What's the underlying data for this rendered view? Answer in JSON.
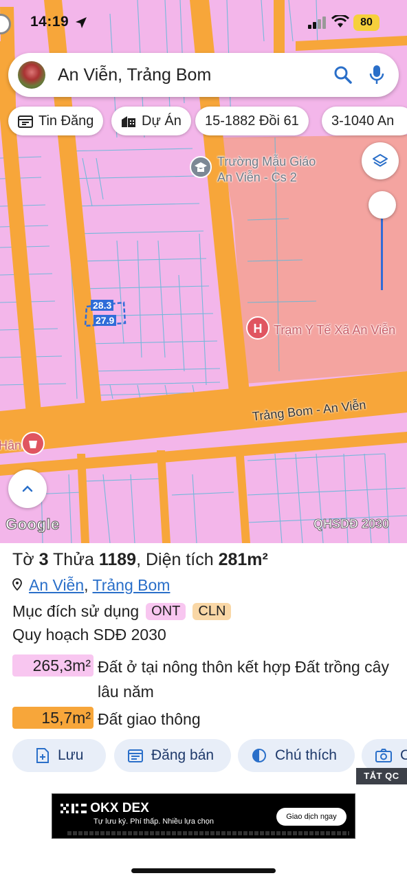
{
  "status_bar": {
    "time": "14:19",
    "battery": "80"
  },
  "search": {
    "query": "An Viễn, Trảng Bom"
  },
  "chips": [
    {
      "label": "Tin Đăng",
      "icon": "calendar-icon"
    },
    {
      "label": "Dự Án",
      "icon": "buildings-icon"
    },
    {
      "label": "15-1882 Đồi 61"
    },
    {
      "label": "3-1040 An"
    }
  ],
  "map": {
    "pois": [
      {
        "name": "Trường Mẫu Giáo An Viễn - Cs 2",
        "line1": "Trường Mẫu Giáo",
        "line2": "An Viễn - Cs 2",
        "icon": "school-icon"
      },
      {
        "name": "Trạm Y Tế Xã An Viễn",
        "icon": "hospital-icon"
      },
      {
        "name": "Hân",
        "icon": "shop-pin-icon"
      }
    ],
    "road": "Trảng Bom - An Viễn",
    "dimensions": [
      "28.3",
      "27.9"
    ],
    "attribution": "Google",
    "overlay_label": "QHSDĐ 2030",
    "colors": {
      "residential": "#f3b6ea",
      "road": "#f7a63a",
      "public": "#f4a4a0",
      "selection": "#2f6cd8"
    }
  },
  "parcel": {
    "title_prefix": "Tờ",
    "sheet_no": "3",
    "parcel_prefix": "Thửa",
    "parcel_no": "1189",
    "area_prefix": ", Diện tích",
    "area": "281m²",
    "ward": "An Viễn",
    "district": "Trảng Bom",
    "purpose_label": "Mục đích sử dụng",
    "purpose_tags": [
      "ONT",
      "CLN"
    ],
    "plan_label": "Quy hoạch SDĐ 2030",
    "plan_items": [
      {
        "area": "265,3m²",
        "desc": "Đất ở tại nông thôn kết hợp Đất trồng cây lâu năm",
        "color": "#f8c6f0"
      },
      {
        "area": "15,7m²",
        "desc": "Đất giao thông",
        "color": "#f7a63a"
      }
    ]
  },
  "actions": [
    {
      "label": "Lưu",
      "icon": "save-doc-icon"
    },
    {
      "label": "Đăng bán",
      "icon": "calendar-list-icon"
    },
    {
      "label": "Chú thích",
      "icon": "half-circle-icon"
    },
    {
      "label": "C",
      "icon": "camera-icon"
    }
  ],
  "ad": {
    "close_label": "TẮT QC",
    "brand": "OKX DEX",
    "tagline": "Tự lưu ký. Phí thấp. Nhiều lựa chọn",
    "cta": "Giao dịch ngay"
  }
}
